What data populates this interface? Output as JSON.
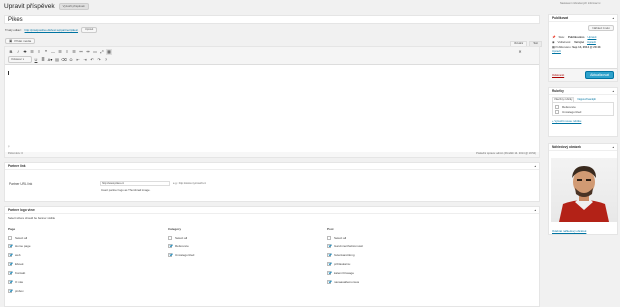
{
  "admin_bar": {
    "screen_options": "Nastavení zobrazených informací ▾"
  },
  "header": {
    "title": "Upravit příspěvek",
    "add_new": "Vytvořit příspěvek"
  },
  "post": {
    "title_value": "Pikes",
    "permalink_label": "Trvalý odkaz:",
    "permalink_url": "http://pixelpositive.dk/test-wp/partner/pikes/",
    "permalink_button": "Upravit"
  },
  "editor": {
    "add_media": "Přidat média",
    "tab_visual": "Vizuální",
    "tab_text": "Text",
    "format_select": "Odstavec",
    "path": "p",
    "word_count": "Počet slov: 0",
    "last_edited": "Poslední úprava: admin (Pondělí 14. 2014 @ 19:54)"
  },
  "partner_link": {
    "title": "Partner link",
    "label": "Partner URL link",
    "value": "http://www.pikes.cc",
    "hint": "e.g.: http://www.mycrosoft.cc",
    "note": "Insert partner logo as Thumbnail image."
  },
  "partner_logo": {
    "title": "Partner logo view",
    "desc": "Select where should be banner visible",
    "col_page": "Page",
    "col_category": "Category",
    "col_post": "Post",
    "select_all": "Select all",
    "pages": [
      {
        "label": "Home page",
        "checked": true
      },
      {
        "label": "web",
        "checked": true
      },
      {
        "label": "Eboek",
        "checked": true
      },
      {
        "label": "Kontakt",
        "checked": true
      },
      {
        "label": "O nás",
        "checked": true
      },
      {
        "label": "pixbox",
        "checked": true
      }
    ],
    "categories": [
      {
        "label": "Reference",
        "checked": true
      },
      {
        "label": "Uncategorized",
        "checked": true
      }
    ],
    "posts": [
      {
        "label": "Garvinnerthebiomusic",
        "checked": true
      },
      {
        "label": "hulenkarottlong",
        "checked": true
      },
      {
        "label": "prihlaskarnu",
        "checked": true
      },
      {
        "label": "kalemrClosage",
        "checked": true
      },
      {
        "label": "nanaasafiemonsus",
        "checked": true
      }
    ]
  },
  "publish": {
    "title": "Publikovat",
    "preview_btn": "Náhled změn",
    "status_label": "Stav:",
    "status_value": "Publikováno",
    "status_edit": "Upravit",
    "visibility_label": "Viditelnost:",
    "visibility_value": "Veřejné",
    "visibility_edit": "Upravit",
    "published_label": "Publikováno:",
    "published_value": "Sep 14, 2014 @ 20:43",
    "published_edit": "Upravit",
    "trash": "Odstranit",
    "update_btn": "Aktualizovat"
  },
  "categories_box": {
    "title": "Rubriky",
    "tab_all": "Všechny rubriky",
    "tab_popular": "Nejpoužívanější",
    "items": [
      {
        "label": "Reference",
        "checked": false
      },
      {
        "label": "Uncategorized",
        "checked": false
      }
    ],
    "add_new": "+ Vytvořit novou rubriku"
  },
  "featured": {
    "title": "Náhledový obrázek",
    "remove": "Odebrat náhledový obrázek"
  },
  "colors": {
    "accent": "#2ea2cc",
    "link": "#0074a2"
  }
}
